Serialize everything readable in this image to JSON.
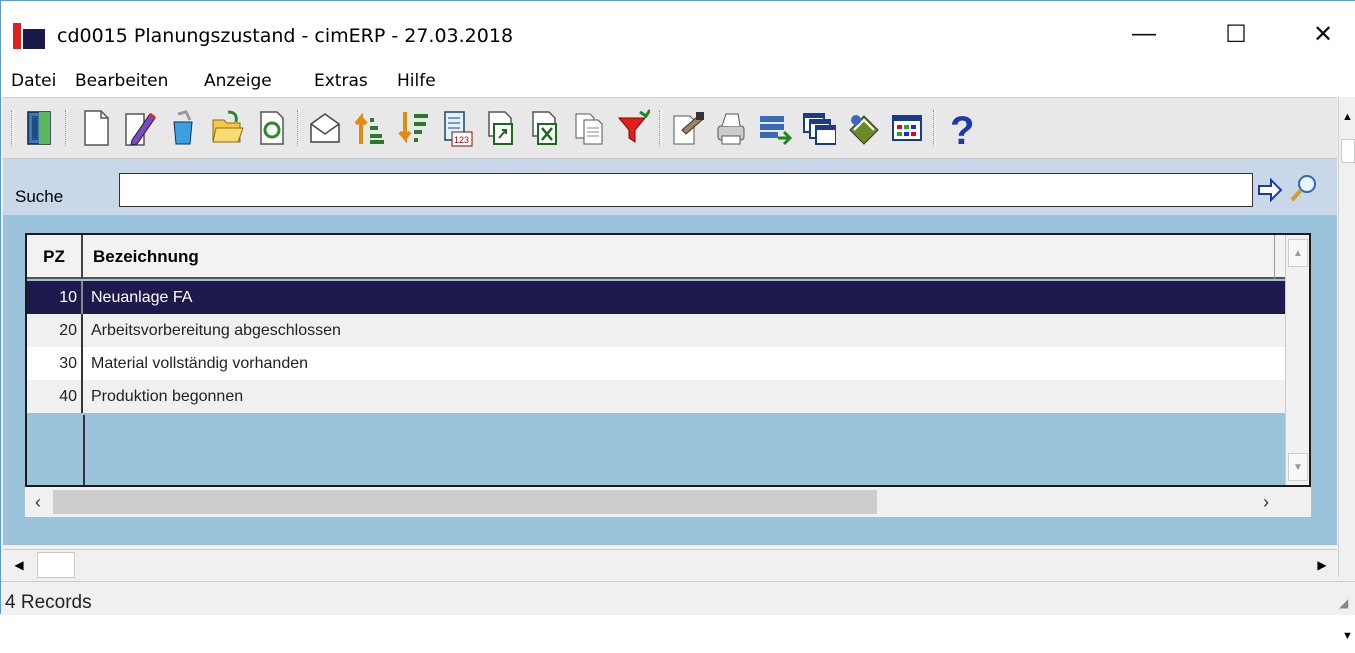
{
  "window": {
    "title": "cd0015 Planungszustand - cimERP - 27.03.2018",
    "minimize_glyph": "—",
    "maximize_glyph": "☐",
    "close_glyph": "✕"
  },
  "menu": {
    "items": [
      "Datei",
      "Bearbeiten",
      "Anzeige",
      "Extras",
      "Hilfe"
    ]
  },
  "toolbar": {
    "icons": [
      "exit-door-icon",
      "new-document-icon",
      "edit-pencil-icon",
      "copy-recycle-icon",
      "open-folder-icon",
      "refresh-icon",
      "email-envelope-icon",
      "sort-ascending-icon",
      "sort-descending-icon",
      "numbering-123-icon",
      "export-icon",
      "excel-icon",
      "copy-pages-icon",
      "filter-funnel-icon",
      "properties-icon",
      "print-icon",
      "save-list-icon",
      "windows-icon",
      "book-icon",
      "grid-layout-icon",
      "help-question-icon"
    ]
  },
  "search": {
    "label": "Suche",
    "value": ""
  },
  "grid": {
    "columns": [
      "PZ",
      "Bezeichnung"
    ],
    "rows": [
      {
        "pz": "10",
        "bezeichnung": "Neuanlage FA",
        "selected": true
      },
      {
        "pz": "20",
        "bezeichnung": "Arbeitsvorbereitung abgeschlossen",
        "selected": false
      },
      {
        "pz": "30",
        "bezeichnung": "Material vollständig vorhanden",
        "selected": false
      },
      {
        "pz": "40",
        "bezeichnung": "Produktion begonnen",
        "selected": false
      }
    ]
  },
  "status": {
    "text": "4 Records"
  },
  "colors": {
    "selected_row": "#1e1a4e",
    "content_bg": "#9cc3dc",
    "search_bg": "#c8d8e8"
  }
}
